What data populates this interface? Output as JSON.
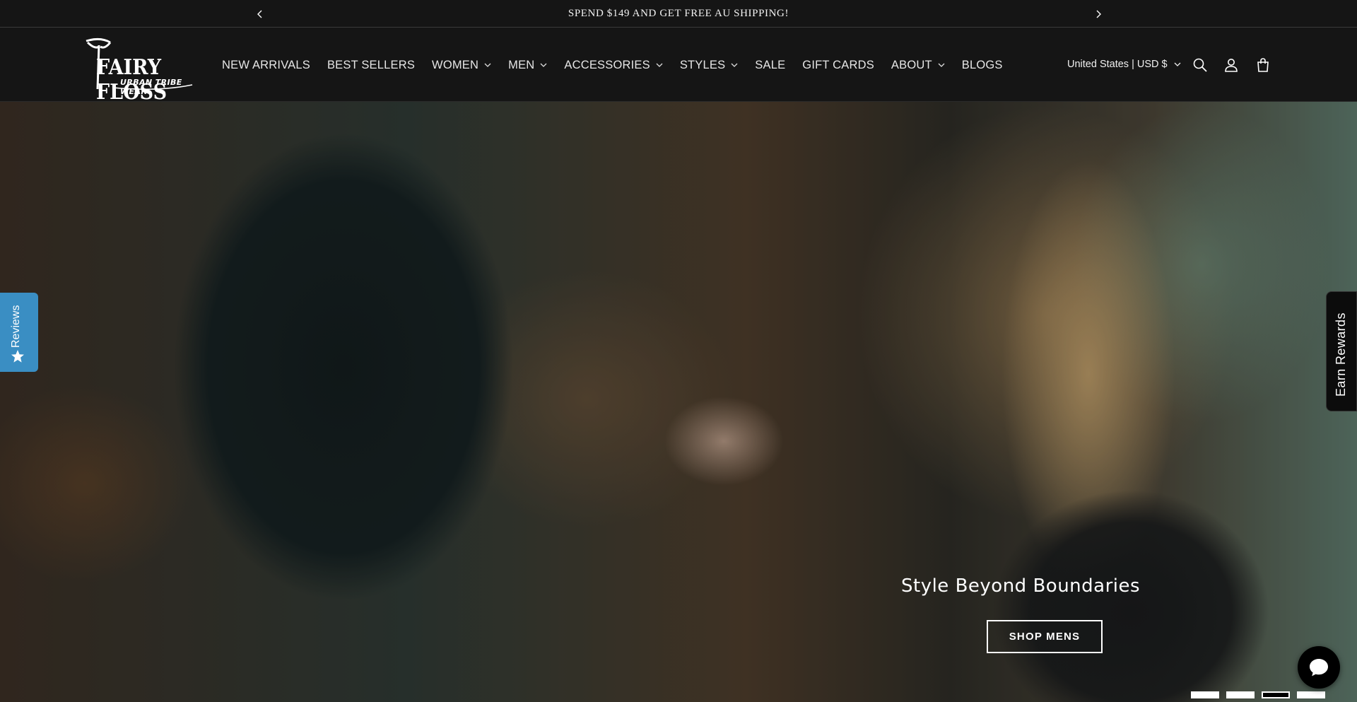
{
  "announcement": {
    "text": "SPEND $149 AND GET FREE AU SHIPPING!",
    "prev_icon": "chevron-left-icon",
    "next_icon": "chevron-right-icon"
  },
  "logo": {
    "title": "FAIRY FLOSS",
    "subtitle": "URBAN TRIBE WEAR"
  },
  "nav": {
    "items": [
      {
        "label": "NEW ARRIVALS",
        "has_dropdown": false
      },
      {
        "label": "BEST SELLERS",
        "has_dropdown": false
      },
      {
        "label": "WOMEN",
        "has_dropdown": true
      },
      {
        "label": "MEN",
        "has_dropdown": true
      },
      {
        "label": "ACCESSORIES",
        "has_dropdown": true
      },
      {
        "label": "STYLES",
        "has_dropdown": true
      },
      {
        "label": "SALE",
        "has_dropdown": false
      },
      {
        "label": "GIFT CARDS",
        "has_dropdown": false
      },
      {
        "label": "ABOUT",
        "has_dropdown": true
      },
      {
        "label": "BLOGS",
        "has_dropdown": false
      }
    ]
  },
  "header": {
    "locale": "United States | USD $",
    "icons": [
      "search-icon",
      "account-icon",
      "cart-icon"
    ]
  },
  "hero": {
    "heading": "Style Beyond Boundaries",
    "button_label": "SHOP MENS",
    "slides_count": 4,
    "active_slide": 3
  },
  "widgets": {
    "reviews_label": "Reviews",
    "rewards_label": "Earn Rewards",
    "chat_icon": "chat-icon"
  },
  "colors": {
    "header_bg": "#151515",
    "reviews_tab": "#3a8ec3",
    "text": "#ffffff"
  }
}
